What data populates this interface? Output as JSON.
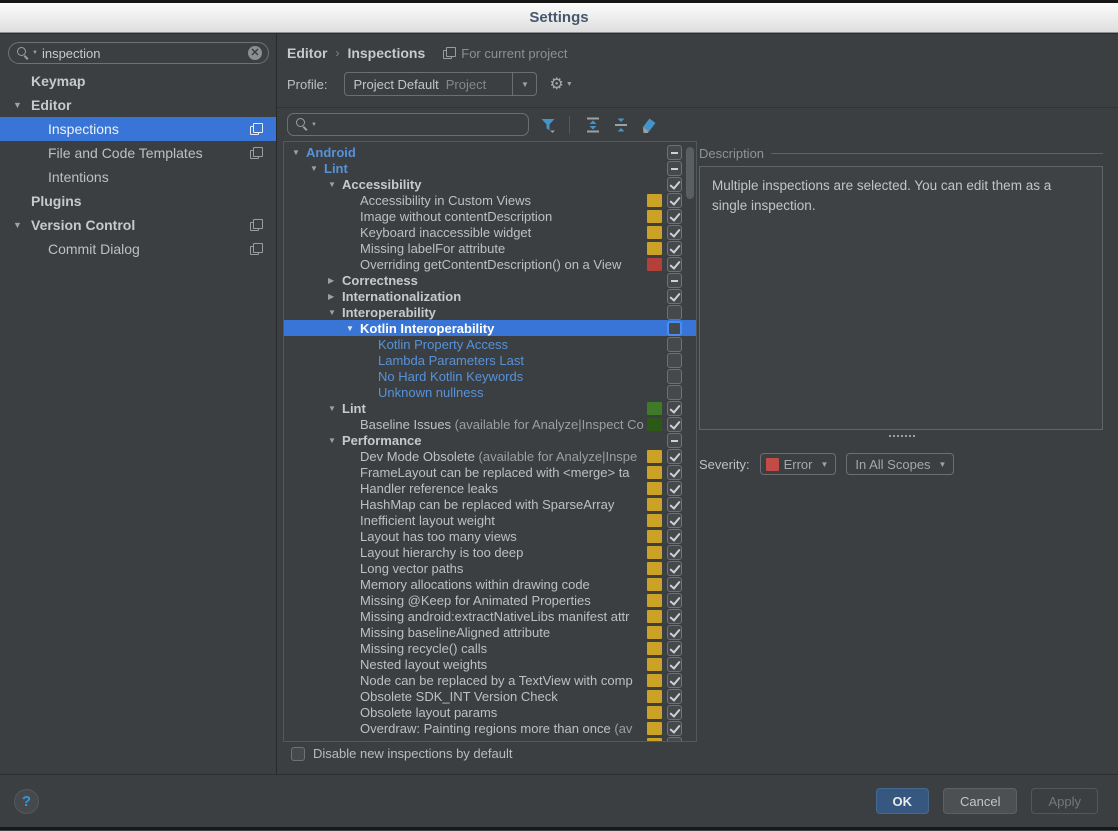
{
  "window": {
    "title": "Settings"
  },
  "palette": {
    "selection": "#3875d6",
    "yellow": "#c9a227",
    "red": "#b4403a",
    "green": "#3f7a28",
    "green_dark": "#2c5a16",
    "blue_text": "#5692da"
  },
  "sidebar": {
    "search": {
      "value": "inspection"
    },
    "items": [
      {
        "label": "Keymap",
        "bold": true,
        "level": 0,
        "arrow": false,
        "page_icon": false,
        "selected": false
      },
      {
        "label": "Editor",
        "bold": true,
        "level": 0,
        "arrow": true,
        "page_icon": false,
        "selected": false
      },
      {
        "label": "Inspections",
        "bold": false,
        "level": 1,
        "arrow": false,
        "page_icon": true,
        "selected": true
      },
      {
        "label": "File and Code Templates",
        "bold": false,
        "level": 1,
        "arrow": false,
        "page_icon": true,
        "selected": false
      },
      {
        "label": "Intentions",
        "bold": false,
        "level": 1,
        "arrow": false,
        "page_icon": false,
        "selected": false
      },
      {
        "label": "Plugins",
        "bold": true,
        "level": 0,
        "arrow": false,
        "page_icon": false,
        "selected": false
      },
      {
        "label": "Version Control",
        "bold": true,
        "level": 0,
        "arrow": true,
        "page_icon": true,
        "selected": false
      },
      {
        "label": "Commit Dialog",
        "bold": false,
        "level": 1,
        "arrow": false,
        "page_icon": true,
        "selected": false
      }
    ]
  },
  "header": {
    "breadcrumb": {
      "part1": "Editor",
      "sep": "›",
      "part2": "Inspections"
    },
    "scope_note": "For current project",
    "profile": {
      "label": "Profile:",
      "value": "Project Default",
      "suffix": "Project"
    }
  },
  "toolbar": {
    "search_value": "",
    "icons": [
      "filter",
      "expand-all",
      "collapse-all",
      "reset"
    ]
  },
  "tree": {
    "rows": [
      {
        "label": "Android",
        "level": 0,
        "arrow": "down",
        "bold": true,
        "blue": true,
        "check": "dash"
      },
      {
        "label": "Lint",
        "level": 1,
        "arrow": "down",
        "bold": true,
        "blue": true,
        "check": "dash"
      },
      {
        "label": "Accessibility",
        "level": 2,
        "arrow": "down",
        "bold": true,
        "check": "checked"
      },
      {
        "label": "Accessibility in Custom Views",
        "level": 3,
        "square": "yellow",
        "check": "checked"
      },
      {
        "label": "Image without contentDescription",
        "level": 3,
        "square": "yellow",
        "check": "checked"
      },
      {
        "label": "Keyboard inaccessible widget",
        "level": 3,
        "square": "yellow",
        "check": "checked"
      },
      {
        "label": "Missing labelFor attribute",
        "level": 3,
        "square": "yellow",
        "check": "checked"
      },
      {
        "label": "Overriding getContentDescription() on a View",
        "level": 3,
        "square": "red",
        "check": "checked"
      },
      {
        "label": "Correctness",
        "level": 2,
        "arrow": "right",
        "bold": true,
        "check": "dash"
      },
      {
        "label": "Internationalization",
        "level": 2,
        "arrow": "right",
        "bold": true,
        "check": "checked"
      },
      {
        "label": "Interoperability",
        "level": 2,
        "arrow": "down",
        "bold": true,
        "check": "empty"
      },
      {
        "label": "Kotlin Interoperability",
        "level": 3,
        "arrow": "down",
        "bold": true,
        "selected": true,
        "check": "empty",
        "focus": true
      },
      {
        "label": "Kotlin Property Access",
        "level": 4,
        "blue": true,
        "check": "empty"
      },
      {
        "label": "Lambda Parameters Last",
        "level": 4,
        "blue": true,
        "check": "empty"
      },
      {
        "label": "No Hard Kotlin Keywords",
        "level": 4,
        "blue": true,
        "check": "empty"
      },
      {
        "label": "Unknown nullness",
        "level": 4,
        "blue": true,
        "check": "empty"
      },
      {
        "label": "Lint",
        "level": 2,
        "arrow": "down",
        "bold": true,
        "square": "green",
        "check": "checked"
      },
      {
        "label": "Baseline Issues",
        "suffix": " (available for Analyze|Inspect Co",
        "level": 3,
        "square": "green_dark",
        "check": "checked"
      },
      {
        "label": "Performance",
        "level": 2,
        "arrow": "down",
        "bold": true,
        "check": "dash"
      },
      {
        "label": "Dev Mode Obsolete",
        "suffix": " (available for Analyze|Inspe",
        "level": 3,
        "square": "yellow",
        "check": "checked"
      },
      {
        "label": "FrameLayout can be replaced with <merge> ta",
        "level": 3,
        "square": "yellow",
        "check": "checked"
      },
      {
        "label": "Handler reference leaks",
        "level": 3,
        "square": "yellow",
        "check": "checked"
      },
      {
        "label": "HashMap can be replaced with SparseArray",
        "level": 3,
        "square": "yellow",
        "check": "checked"
      },
      {
        "label": "Inefficient layout weight",
        "level": 3,
        "square": "yellow",
        "check": "checked"
      },
      {
        "label": "Layout has too many views",
        "level": 3,
        "square": "yellow",
        "check": "checked"
      },
      {
        "label": "Layout hierarchy is too deep",
        "level": 3,
        "square": "yellow",
        "check": "checked"
      },
      {
        "label": "Long vector paths",
        "level": 3,
        "square": "yellow",
        "check": "checked"
      },
      {
        "label": "Memory allocations within drawing code",
        "level": 3,
        "square": "yellow",
        "check": "checked"
      },
      {
        "label": "Missing @Keep for Animated Properties",
        "level": 3,
        "square": "yellow",
        "check": "checked"
      },
      {
        "label": "Missing android:extractNativeLibs manifest attr",
        "level": 3,
        "square": "yellow",
        "check": "checked"
      },
      {
        "label": "Missing baselineAligned attribute",
        "level": 3,
        "square": "yellow",
        "check": "checked"
      },
      {
        "label": "Missing recycle() calls",
        "level": 3,
        "square": "yellow",
        "check": "checked"
      },
      {
        "label": "Nested layout weights",
        "level": 3,
        "square": "yellow",
        "check": "checked"
      },
      {
        "label": "Node can be replaced by a TextView with comp",
        "level": 3,
        "square": "yellow",
        "check": "checked"
      },
      {
        "label": "Obsolete SDK_INT Version Check",
        "level": 3,
        "square": "yellow",
        "check": "checked"
      },
      {
        "label": "Obsolete layout params",
        "level": 3,
        "square": "yellow",
        "check": "checked"
      },
      {
        "label": "Overdraw: Painting regions more than once",
        "suffix": " (av",
        "level": 3,
        "square": "yellow",
        "check": "checked"
      },
      {
        "label": "",
        "level": 3,
        "square": "yellow",
        "check": "checked"
      }
    ]
  },
  "description": {
    "title": "Description",
    "text": "Multiple inspections are selected. You can edit them as a single inspection."
  },
  "severity": {
    "label": "Severity:",
    "value": "Error",
    "swatch": "#c34b45",
    "scope": "In All Scopes"
  },
  "footer": {
    "disable_checkbox_label": "Disable new inspections by default"
  },
  "buttons": {
    "ok": "OK",
    "cancel": "Cancel",
    "apply": "Apply"
  },
  "help": {
    "glyph": "?"
  }
}
